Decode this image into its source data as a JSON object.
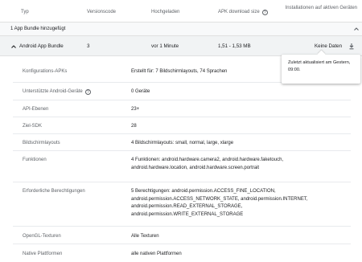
{
  "header": {
    "col_type": "Typ",
    "col_versioncode": "Versionscode",
    "col_uploaded": "Hochgeladen",
    "col_size": "APK download size",
    "col_installs": "Installationen auf aktiven Geräten"
  },
  "group": {
    "label": "1 App Bundle hinzugefügt"
  },
  "bundle": {
    "name": "Android App Bundle",
    "versioncode": "3",
    "uploaded": "vor 1 Minute",
    "size": "1,51 - 1,53 MB",
    "installs": "Keine Daten"
  },
  "tooltip": {
    "text": "Zuletzt aktualisiert am Gestern, 09:00."
  },
  "details": [
    {
      "key": "Konfigurations-APKs",
      "lines": [
        "Erstellt für: 7 Bildschirmlayouts, 74 Sprachen"
      ]
    },
    {
      "key": "Unterstützte Android-Geräte",
      "lines": [
        "0 Geräte"
      ]
    },
    {
      "key": "API-Ebenen",
      "lines": [
        "23+"
      ]
    },
    {
      "key": "Ziel-SDK",
      "lines": [
        "28"
      ]
    },
    {
      "key": "Bildschirmlayouts",
      "lines": [
        "4 Bildschirmlayouts: small, normal, large, xlarge"
      ]
    },
    {
      "key": "Funktionen",
      "lines": [
        "4 Funktionen: android.hardware.camera2, android.hardware.faketouch,",
        "android.hardware.location, android.hardware.screen.portrait"
      ]
    },
    {
      "key": "Erforderliche Berechtigungen",
      "lines": [
        "5 Berechtigungen: android.permission.ACCESS_FINE_LOCATION,",
        "android.permission.ACCESS_NETWORK_STATE, android.permission.INTERNET,",
        "android.permission.READ_EXTERNAL_STORAGE,",
        "android.permission.WRITE_EXTERNAL_STORAGE"
      ]
    },
    {
      "key": "OpenGL-Texturen",
      "lines": [
        "Alle Texturen"
      ]
    },
    {
      "key": "Native Plattformen",
      "lines": [
        "alle nativen Plattformen"
      ]
    }
  ]
}
